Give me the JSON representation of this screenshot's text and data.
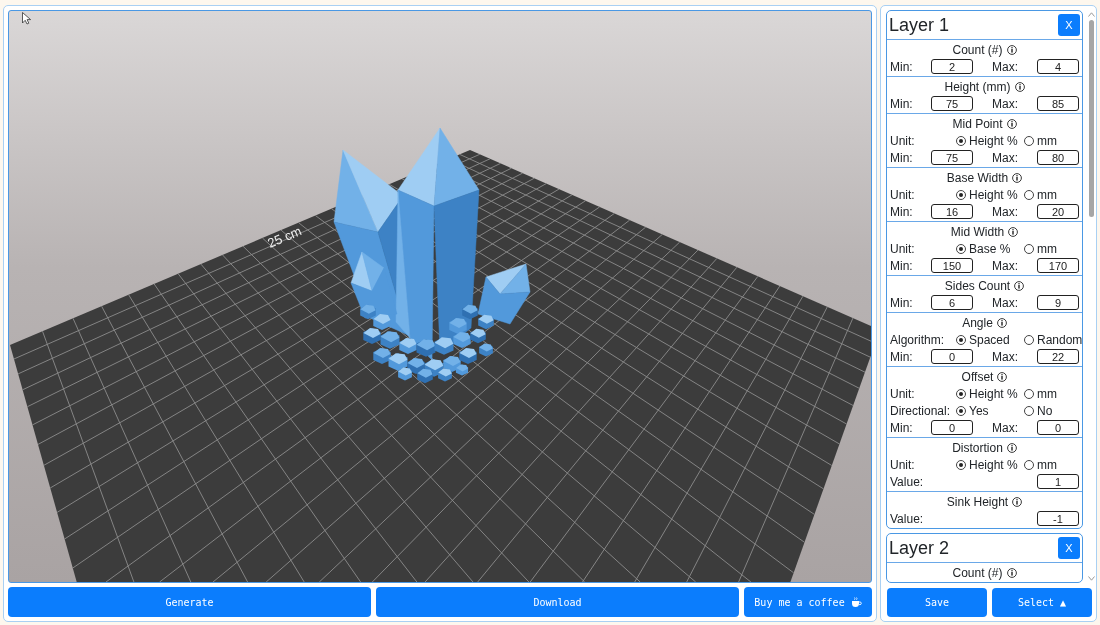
{
  "viewport": {
    "plate_label": "25 cm"
  },
  "actions": [
    {
      "label": "Generate",
      "kind": "primary"
    },
    {
      "label": "Download",
      "kind": "primary"
    },
    {
      "label": "Buy me a coffee",
      "kind": "donate"
    }
  ],
  "layers": [
    {
      "title": "Layer 1",
      "close": "X",
      "sections": [
        {
          "title": "Count (#)",
          "rows": [
            {
              "kind": "range",
              "min_label": "Min:",
              "min": "2",
              "max_label": "Max:",
              "max": "4"
            }
          ]
        },
        {
          "title": "Height (mm)",
          "rows": [
            {
              "kind": "range",
              "min_label": "Min:",
              "min": "75",
              "max_label": "Max:",
              "max": "85"
            }
          ]
        },
        {
          "title": "Mid Point",
          "rows": [
            {
              "kind": "radio",
              "label": "Unit:",
              "options": [
                {
                  "label": "Height %",
                  "selected": true
                },
                {
                  "label": "mm",
                  "selected": false
                }
              ]
            },
            {
              "kind": "range",
              "min_label": "Min:",
              "min": "75",
              "max_label": "Max:",
              "max": "80"
            }
          ]
        },
        {
          "title": "Base Width",
          "rows": [
            {
              "kind": "radio",
              "label": "Unit:",
              "options": [
                {
                  "label": "Height %",
                  "selected": true
                },
                {
                  "label": "mm",
                  "selected": false
                }
              ]
            },
            {
              "kind": "range",
              "min_label": "Min:",
              "min": "16",
              "max_label": "Max:",
              "max": "20"
            }
          ]
        },
        {
          "title": "Mid Width",
          "rows": [
            {
              "kind": "radio",
              "label": "Unit:",
              "options": [
                {
                  "label": "Base %",
                  "selected": true
                },
                {
                  "label": "mm",
                  "selected": false
                }
              ]
            },
            {
              "kind": "range",
              "min_label": "Min:",
              "min": "150",
              "max_label": "Max:",
              "max": "170"
            }
          ]
        },
        {
          "title": "Sides Count",
          "rows": [
            {
              "kind": "range",
              "min_label": "Min:",
              "min": "6",
              "max_label": "Max:",
              "max": "9"
            }
          ]
        },
        {
          "title": "Angle",
          "rows": [
            {
              "kind": "radio",
              "label": "Algorithm:",
              "options": [
                {
                  "label": "Spaced",
                  "selected": true
                },
                {
                  "label": "Random",
                  "selected": false
                }
              ]
            },
            {
              "kind": "range",
              "min_label": "Min:",
              "min": "0",
              "max_label": "Max:",
              "max": "22"
            }
          ]
        },
        {
          "title": "Offset",
          "rows": [
            {
              "kind": "radio",
              "label": "Unit:",
              "options": [
                {
                  "label": "Height %",
                  "selected": true
                },
                {
                  "label": "mm",
                  "selected": false
                }
              ]
            },
            {
              "kind": "radio",
              "label": "Directional:",
              "options": [
                {
                  "label": "Yes",
                  "selected": true
                },
                {
                  "label": "No",
                  "selected": false
                }
              ]
            },
            {
              "kind": "range",
              "min_label": "Min:",
              "min": "0",
              "max_label": "Max:",
              "max": "0"
            }
          ]
        },
        {
          "title": "Distortion",
          "rows": [
            {
              "kind": "radio",
              "label": "Unit:",
              "options": [
                {
                  "label": "Height %",
                  "selected": true
                },
                {
                  "label": "mm",
                  "selected": false
                }
              ]
            },
            {
              "kind": "value",
              "label": "Value:",
              "value": "1"
            }
          ]
        },
        {
          "title": "Sink Height",
          "rows": [
            {
              "kind": "value",
              "label": "Value:",
              "value": "-1"
            }
          ]
        }
      ]
    },
    {
      "title": "Layer 2",
      "close": "X",
      "sections": [
        {
          "title": "Count (#)"
        }
      ]
    }
  ],
  "panel_buttons": [
    {
      "label": "Save"
    },
    {
      "label": "Select ▲"
    }
  ]
}
